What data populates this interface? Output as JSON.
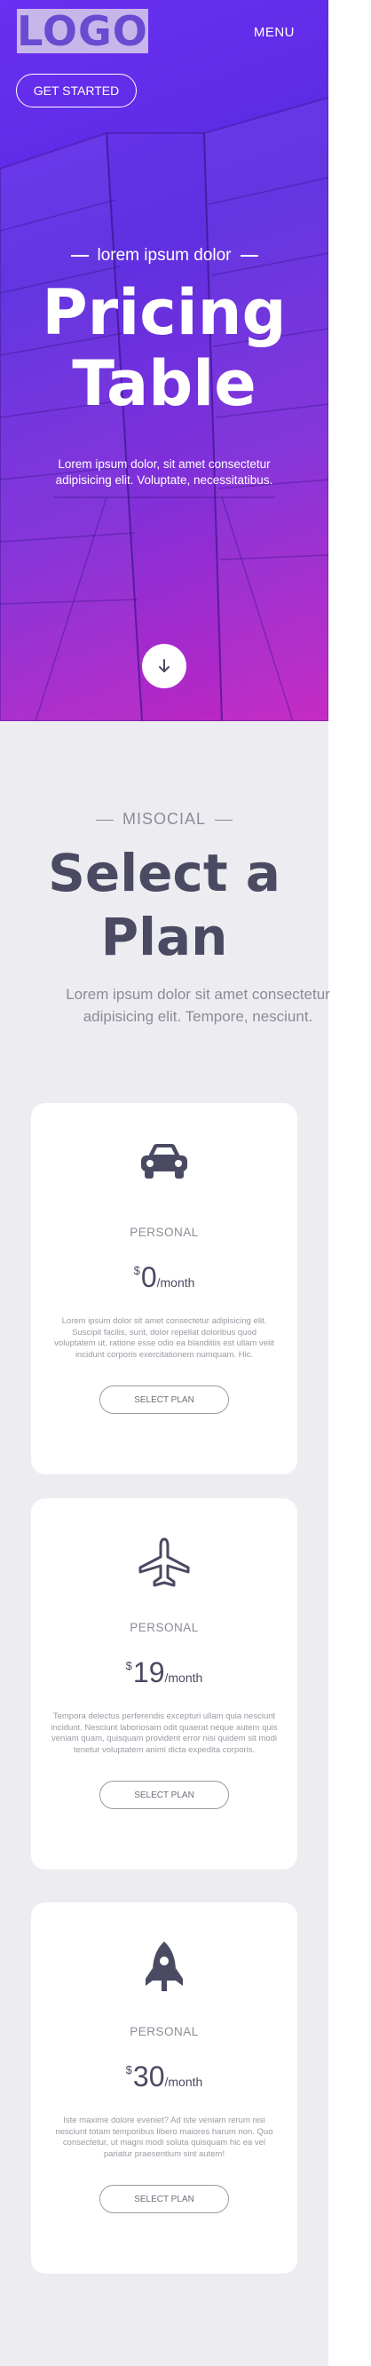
{
  "header": {
    "logo": "LOGO",
    "menu_label": "MENU",
    "cta_label": "GET STARTED"
  },
  "hero": {
    "eyebrow": "lorem ipsum dolor",
    "title_line1": "Pricing",
    "title_line2": "Table",
    "subtitle": "Lorem ipsum dolor, sit amet consectetur adipisicing elit. Voluptate, necessitatibus."
  },
  "pricing": {
    "eyebrow": "MISOCIAL",
    "title_line1": "Select a",
    "title_line2": "Plan",
    "subtitle": "Lorem ipsum dolor sit amet consectetur adipisicing elit. Tempore, nesciunt.",
    "plans": [
      {
        "icon": "car-icon",
        "tier": "PERSONAL",
        "currency": "$",
        "amount": "0",
        "period": "/month",
        "description": "Lorem ipsum dolor sit amet consectetur adipisicing elit. Suscipit facilis, sunt, dolor repellat doloribus quod voluptatem ut, ratione esse odio ea blanditiis est ullam velit incidunt corporis exercitationem numquam. Hic.",
        "button_label": "SELECT PLAN"
      },
      {
        "icon": "airplane-icon",
        "tier": "PERSONAL",
        "currency": "$",
        "amount": "19",
        "period": "/month",
        "description": "Tempora delectus perferendis excepturi ullam quia nesciunt incidunt. Nesciunt laboriosam odit quaerat neque autem quis veniam quam, quisquam provident error nisi quidem sit modi tenetur voluptatem animi dicta expedita corporis.",
        "button_label": "SELECT PLAN"
      },
      {
        "icon": "rocket-icon",
        "tier": "PERSONAL",
        "currency": "$",
        "amount": "30",
        "period": "/month",
        "description": "Iste maxime dolore eveniet? Ad iste veniam rerum nisi nesciunt totam temporibus libero maiores harum non. Quo consectetur, ut magni modi soluta quisquam hic ea vel pariatur praesentium sint autem!",
        "button_label": "SELECT PLAN"
      }
    ]
  },
  "colors": {
    "hero_gradient_start": "#6a2ff2",
    "hero_gradient_end": "#c21fc0",
    "section_bg": "#ededf1",
    "heading": "#4b4a63",
    "muted": "#8a8c97"
  }
}
